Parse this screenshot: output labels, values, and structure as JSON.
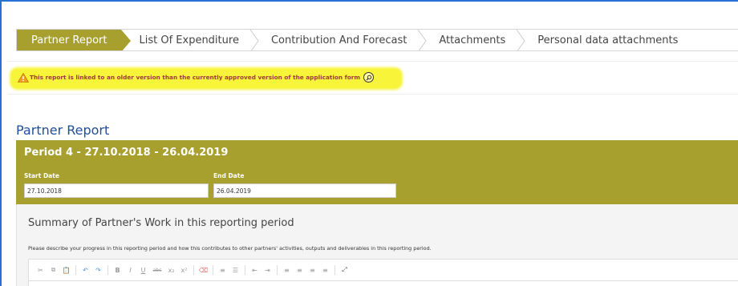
{
  "tabs": [
    {
      "label": "Partner Report",
      "active": true
    },
    {
      "label": "List Of Expenditure",
      "active": false
    },
    {
      "label": "Contribution And Forecast",
      "active": false
    },
    {
      "label": "Attachments",
      "active": false
    },
    {
      "label": "Personal data attachments",
      "active": false
    }
  ],
  "warning": {
    "text": "This report is linked to an older version than the currently approved version of the application form",
    "icon": "warning-triangle-icon",
    "action_icon": "magnifier-icon",
    "highlight_color": "#f8f43a"
  },
  "report": {
    "section_title": "Partner Report",
    "period_title": "Period 4 - 27.10.2018 - 26.04.2019",
    "start_label": "Start Date",
    "start_value": "27.10.2018",
    "end_label": "End Date",
    "end_value": "26.04.2019",
    "panel_color": "#a8a02e"
  },
  "summary": {
    "title": "Summary of Partner's Work in this reporting period",
    "description": "Please describe your progress in this reporting period and how this contributes to other partners' activities, outputs and deliverables in this reporting period."
  },
  "toolbar": {
    "buttons": [
      {
        "name": "cut-icon",
        "glyph": "✂"
      },
      {
        "name": "copy-icon",
        "glyph": "⧉"
      },
      {
        "name": "paste-icon",
        "glyph": "📋"
      },
      {
        "name": "undo-icon",
        "glyph": "↶"
      },
      {
        "name": "redo-icon",
        "glyph": "↷"
      },
      {
        "name": "bold-icon",
        "glyph": "B"
      },
      {
        "name": "italic-icon",
        "glyph": "I"
      },
      {
        "name": "underline-icon",
        "glyph": "U"
      },
      {
        "name": "strikethrough-icon",
        "glyph": "abc"
      },
      {
        "name": "subscript-icon",
        "glyph": "x₂"
      },
      {
        "name": "superscript-icon",
        "glyph": "x²"
      },
      {
        "name": "remove-format-icon",
        "glyph": "⌫"
      },
      {
        "name": "numbered-list-icon",
        "glyph": "≡"
      },
      {
        "name": "bulleted-list-icon",
        "glyph": "☰"
      },
      {
        "name": "outdent-icon",
        "glyph": "⇤"
      },
      {
        "name": "indent-icon",
        "glyph": "⇥"
      },
      {
        "name": "align-left-icon",
        "glyph": "≡"
      },
      {
        "name": "align-center-icon",
        "glyph": "≡"
      },
      {
        "name": "align-right-icon",
        "glyph": "≡"
      },
      {
        "name": "justify-icon",
        "glyph": "≡"
      },
      {
        "name": "maximize-icon",
        "glyph": "⤢"
      }
    ]
  }
}
